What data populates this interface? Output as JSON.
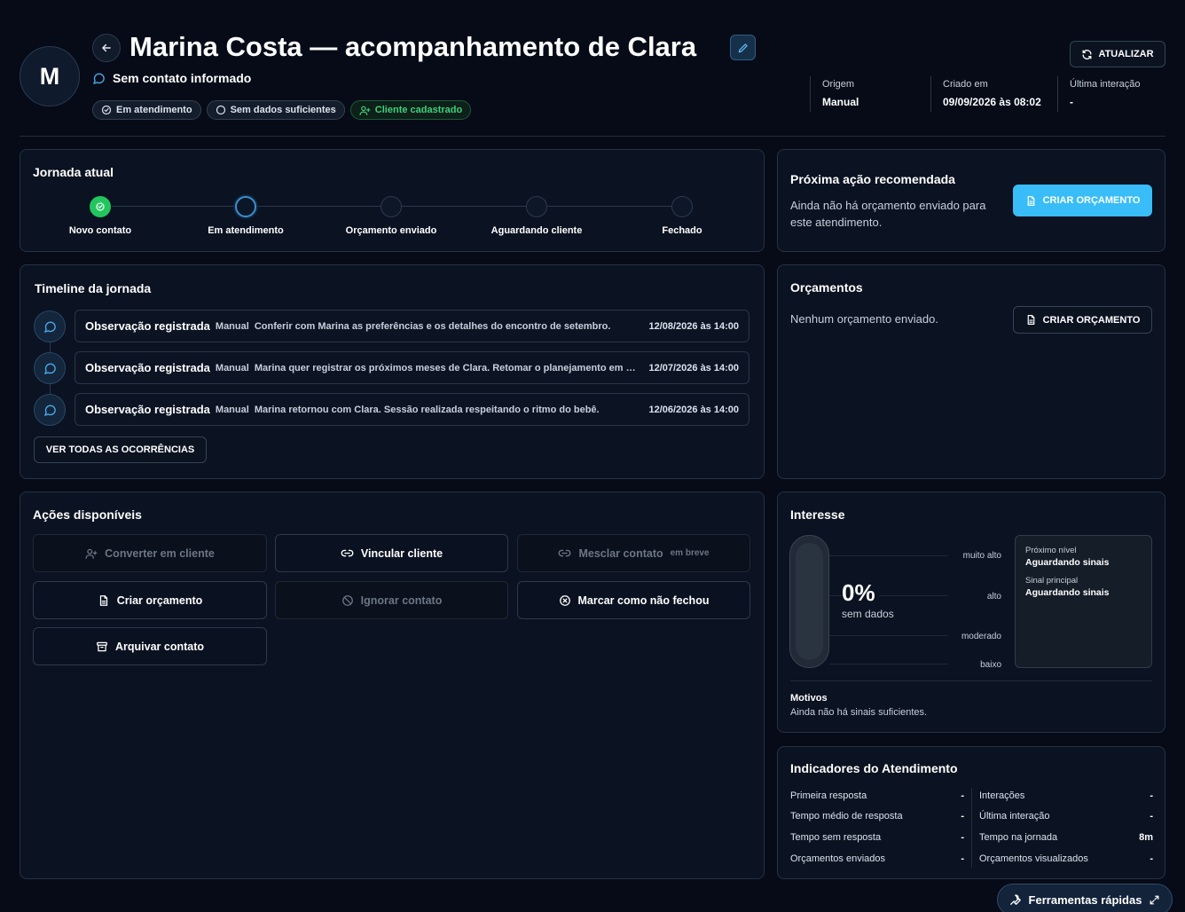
{
  "header": {
    "avatar_initial": "M",
    "title": "Marina Costa — acompanhamento de Clara",
    "contact": "Sem contato informado",
    "chips": [
      "Em atendimento",
      "Sem dados suficientes",
      "Cliente cadastrado"
    ],
    "update_label": "ATUALIZAR",
    "meta": [
      {
        "label": "Origem",
        "value": "Manual"
      },
      {
        "label": "Criado em",
        "value": "09/09/2026 às 08:02"
      },
      {
        "label": "Última interação",
        "value": "-"
      }
    ]
  },
  "journey": {
    "title": "Jornada atual",
    "steps": [
      "Novo contato",
      "Em atendimento",
      "Orçamento enviado",
      "Aguardando cliente",
      "Fechado"
    ],
    "current_step": 1
  },
  "timeline": {
    "title": "Timeline da jornada",
    "items": [
      {
        "title": "Observação registrada",
        "source": "Manual",
        "desc": "Conferir com Marina as preferências e os detalhes do encontro de setembro.",
        "date": "12/08/2026 às 14:00"
      },
      {
        "title": "Observação registrada",
        "source": "Manual",
        "desc": "Marina quer registrar os próximos meses de Clara. Retomar o planejamento em co...",
        "date": "12/07/2026 às 14:00"
      },
      {
        "title": "Observação registrada",
        "source": "Manual",
        "desc": "Marina retornou com Clara. Sessão realizada respeitando o ritmo do bebê.",
        "date": "12/06/2026 às 14:00"
      }
    ],
    "see_all": "VER TODAS AS OCORRÊNCIAS"
  },
  "actions": {
    "title": "Ações disponíveis",
    "convert": "Converter em cliente",
    "link": "Vincular cliente",
    "merge": "Mesclar contato",
    "merge_soon": "em breve",
    "create_quote": "Criar orçamento",
    "ignore": "Ignorar contato",
    "not_closed": "Marcar como não fechou",
    "archive": "Arquivar contato"
  },
  "next_action": {
    "title": "Próxima ação recomendada",
    "text": "Ainda não há orçamento enviado para este atendimento.",
    "button": "CRIAR ORÇAMENTO"
  },
  "quotes": {
    "title": "Orçamentos",
    "empty": "Nenhum orçamento enviado.",
    "button": "CRIAR ORÇAMENTO"
  },
  "interest": {
    "title": "Interesse",
    "percent": "0%",
    "percent_value": 0,
    "status": "sem dados",
    "levels": [
      "muito alto",
      "alto",
      "moderado",
      "baixo"
    ],
    "next_level_label": "Próximo nível",
    "next_level_value": "Aguardando sinais",
    "main_signal_label": "Sinal principal",
    "main_signal_value": "Aguardando sinais",
    "reasons_label": "Motivos",
    "reasons_text": "Ainda não há sinais suficientes."
  },
  "indicators": {
    "title": "Indicadores do Atendimento",
    "left": [
      {
        "label": "Primeira resposta",
        "value": "-"
      },
      {
        "label": "Tempo médio de resposta",
        "value": "-"
      },
      {
        "label": "Tempo sem resposta",
        "value": "-"
      },
      {
        "label": "Orçamentos enviados",
        "value": "-"
      }
    ],
    "right": [
      {
        "label": "Interações",
        "value": "-"
      },
      {
        "label": "Última interação",
        "value": "-"
      },
      {
        "label": "Tempo na jornada",
        "value": "8m"
      },
      {
        "label": "Orçamentos visualizados",
        "value": "-"
      }
    ]
  },
  "fab": {
    "label": "Ferramentas rápidas"
  },
  "colors": {
    "accent": "#38bdf8",
    "success": "#22c55e",
    "background": "#060b17",
    "panel": "#0b1221"
  }
}
